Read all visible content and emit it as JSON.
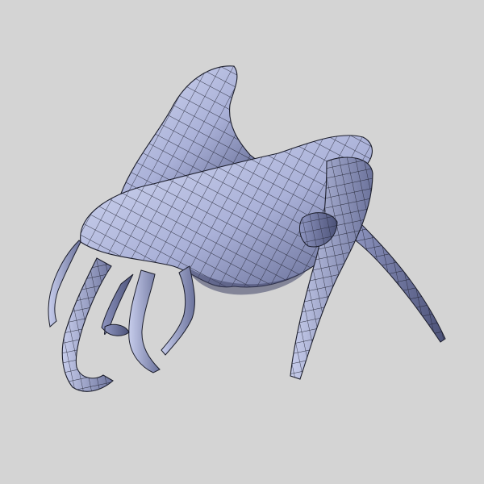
{
  "viewport": {
    "background_color": "#d4d4d4",
    "render_style": "wireframe-on-shaded",
    "subject": "creature-3d-model"
  },
  "palette": {
    "surface_light": "#d3d9f2",
    "surface_mid": "#a9b0d6",
    "surface_dark": "#5f6690",
    "wire": "#1c1e2c"
  }
}
